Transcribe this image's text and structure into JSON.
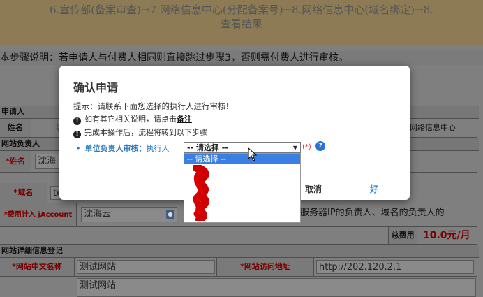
{
  "banner": {
    "line1": "6.宣传部(备案审查)→7.网络信息中心(分配备案号)→8.网络信息中心(域名绑定)→8.",
    "line2": "查看结果"
  },
  "step_note": "本步骤说明：若申请人与付费人相同则直接跳过步骤3，否则需付费人进行审核。",
  "form": {
    "applicant_section": "申请人",
    "name_label": "姓名",
    "name_value": "沈",
    "applicant_right_value": "网络信息中心",
    "site_owner_section": "网站负责人",
    "owner_name_label": "*姓名",
    "owner_name_value": "沈海",
    "domain_label": "*域名",
    "domain_value": "te",
    "fee_label": "*费用计入 jAccount",
    "fee_value": "沈海云",
    "fee_note": "服务器IP的负责人、域名的负责人的",
    "total_fee_label": "总费用",
    "total_fee_value": "10.0元/月",
    "site_info_section": "网站详细信息登记",
    "cn_name_label": "*网站中文名称",
    "cn_name_value": "测试网站",
    "url_label": "*网站访问地址",
    "url_value": "http://202.120.2.1",
    "desc_value": "测试网站"
  },
  "modal": {
    "title": "确认申请",
    "tip": "提示：请联系下面您选择的执行人进行审核!",
    "item1_text": "如有其它相关说明，请点击",
    "item1_link": "备注",
    "item2_text": "完成本操作后，流程将转到以下步骤",
    "approve_label": "单位负责人审核：",
    "approve_executor": "执行人",
    "select_value": "-- 请选择 --",
    "required_mark": "(*)",
    "help_icon": "?",
    "cancel": "取消",
    "ok": "好"
  },
  "dropdown": {
    "options": [
      "-- 请选择 --"
    ]
  },
  "colors": {
    "link_blue": "#2a7abf",
    "selected_option": "#3b7fe4",
    "redaction": "#cc0000",
    "total_red": "#7a0000"
  }
}
